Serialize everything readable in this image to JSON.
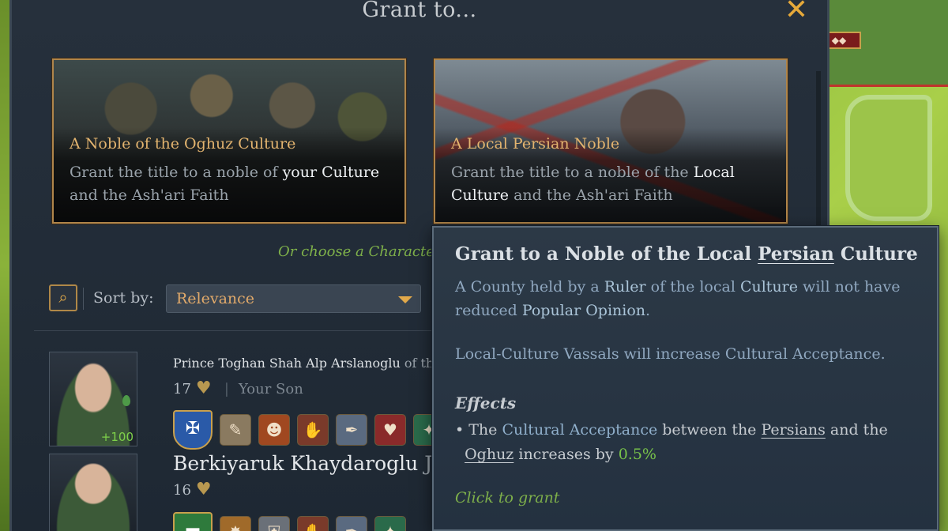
{
  "window": {
    "title": "Grant to...",
    "close_glyph": "✕"
  },
  "cards": [
    {
      "title": "A Noble of the Oghuz Culture",
      "desc_a": "Grant the title to a noble of ",
      "desc_hl1": "your Culture",
      "desc_b": " and the Ash'ari Faith"
    },
    {
      "title": "A Local Persian Noble",
      "desc_a": "Grant the title to a noble of the ",
      "desc_hl1": "Local Culture",
      "desc_b": " and the Ash'ari Faith"
    }
  ],
  "or_choose": "Or choose a Character",
  "sort": {
    "label": "Sort by:",
    "value": "Relevance"
  },
  "characters": [
    {
      "name": "Prince Toghan Shah Alp Arslanoglu",
      "name_rest": " of the",
      "age": "17",
      "relation": "Your Son",
      "bonus": "+100"
    },
    {
      "name": "Berkiyaruk Khaydaroglu",
      "name_rest": " Jabi",
      "age": "16"
    }
  ],
  "tooltip": {
    "title_a": "Grant to a Noble of the Local ",
    "title_u": "Persian",
    "title_b": " Culture",
    "p1_a": "A County held by a ",
    "p1_hl1": "Ruler",
    "p1_b": " of the local ",
    "p1_hl2": "Culture",
    "p1_c": " will not have reduced ",
    "p1_hl3": "Popular Opinion",
    "p1_d": ".",
    "p2_a": "Local-Culture ",
    "p2_hl1": "Vassals",
    "p2_b": " will increase ",
    "p2_hl2": "Cultural Acceptance",
    "p2_c": ".",
    "effects_label": "Effects",
    "effect_a": "• The ",
    "effect_hl1": "Cultural Acceptance",
    "effect_b": " between the ",
    "effect_u1": "Persians",
    "effect_c": " and the ",
    "effect_u2": "Oghuz",
    "effect_d": " increases by ",
    "effect_val": "0.5%",
    "click": "Click to grant"
  },
  "colors": {
    "accent_gold": "#e2a94a",
    "positive_green": "#7eb04a",
    "highlight_blue": "#90b0cc"
  },
  "icons": {
    "close": "close-icon",
    "search": "magnifier-icon",
    "sort_arrow": "chevron-down-icon",
    "age": "heart-icon"
  }
}
